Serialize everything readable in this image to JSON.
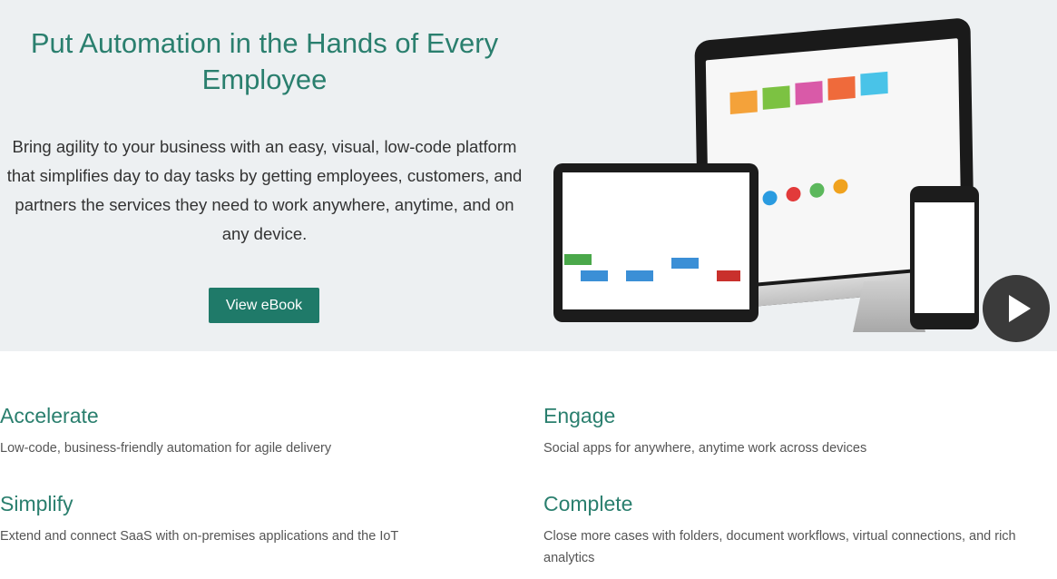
{
  "hero": {
    "title": "Put Automation in the Hands of Every Employee",
    "description": "Bring agility to your business with an easy, visual, low-code platform that simplifies day to day tasks by getting employees, customers, and partners the services they need to work anywhere, anytime, and on any device.",
    "cta_label": "View eBook"
  },
  "features": [
    {
      "title": "Accelerate",
      "description": "Low-code, business-friendly automation for agile delivery"
    },
    {
      "title": "Engage",
      "description": "Social apps for anywhere, anytime work across devices"
    },
    {
      "title": "Simplify",
      "description": "Extend and connect SaaS with on-premises applications and the IoT"
    },
    {
      "title": "Complete",
      "description": "Close more cases with folders, document workflows, virtual connections, and rich analytics"
    }
  ],
  "colors": {
    "accent": "#2a7f6e",
    "button": "#1f7a69",
    "hero_background": "#edf0f2"
  },
  "icons": {
    "play": "play-icon"
  }
}
